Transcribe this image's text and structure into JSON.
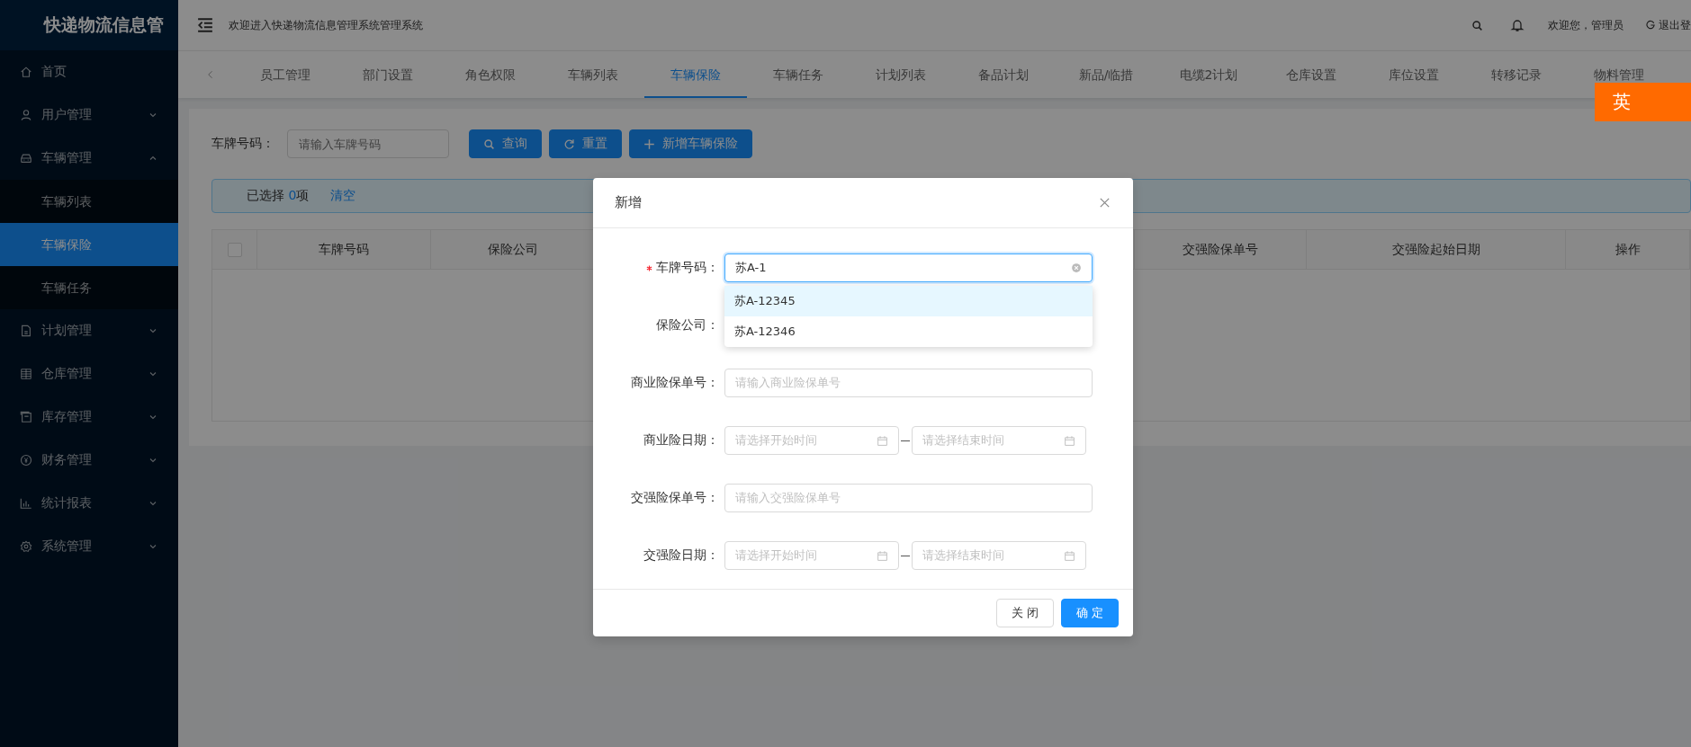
{
  "sidebar": {
    "logo": "快递物流信息管",
    "items": [
      {
        "label": "首页",
        "selected": false
      },
      {
        "label": "用户管理",
        "selected": false,
        "expanded": false
      },
      {
        "label": "车辆管理",
        "selected": false,
        "expanded": true,
        "children": [
          {
            "label": "车辆列表",
            "selected": false
          },
          {
            "label": "车辆保险",
            "selected": true
          },
          {
            "label": "车辆任务",
            "selected": false
          }
        ]
      },
      {
        "label": "计划管理",
        "selected": false,
        "expanded": false
      },
      {
        "label": "仓库管理",
        "selected": false,
        "expanded": false
      },
      {
        "label": "库存管理",
        "selected": false,
        "expanded": false
      },
      {
        "label": "财务管理",
        "selected": false,
        "expanded": false
      },
      {
        "label": "统计报表",
        "selected": false,
        "expanded": false
      },
      {
        "label": "系统管理",
        "selected": false,
        "expanded": false
      }
    ]
  },
  "header": {
    "title": "欢迎进入快递物流信息管理系统管理系统",
    "user": "欢迎您，管理员",
    "logout": "退出登"
  },
  "tabs": [
    {
      "label": "员工管理",
      "selected": false
    },
    {
      "label": "部门设置",
      "selected": false
    },
    {
      "label": "角色权限",
      "selected": false
    },
    {
      "label": "车辆列表",
      "selected": false
    },
    {
      "label": "车辆保险",
      "selected": true
    },
    {
      "label": "车辆任务",
      "selected": false
    },
    {
      "label": "计划列表",
      "selected": false
    },
    {
      "label": "备品计划",
      "selected": false
    },
    {
      "label": "新品/临措",
      "selected": false
    },
    {
      "label": "电缆2计划",
      "selected": false
    },
    {
      "label": "仓库设置",
      "selected": false
    },
    {
      "label": "库位设置",
      "selected": false
    },
    {
      "label": "转移记录",
      "selected": false
    },
    {
      "label": "物料管理",
      "selected": false
    }
  ],
  "ime_badge": "英",
  "search": {
    "label": "车牌号码：",
    "placeholder": "请输入车牌号码",
    "buttons": [
      {
        "label": "查询"
      },
      {
        "label": "重置"
      },
      {
        "label": "新增车辆保险"
      }
    ]
  },
  "selection_bar": {
    "prefix": "已选择 ",
    "count": "0",
    "suffix": "项",
    "clear": "清空"
  },
  "table": {
    "columns": [
      {
        "kind": "checkbox",
        "checked": false
      },
      {
        "label": "车牌号码"
      },
      {
        "label": "保险公司"
      },
      {
        "label": "交强险保单号"
      },
      {
        "label": "交强险起始日期"
      },
      {
        "label": "操作"
      }
    ]
  },
  "dialog": {
    "title": "新增",
    "fields": [
      {
        "label": "车牌号码：",
        "required": true,
        "kind": "autocomplete",
        "value": "苏A-1",
        "focused": true,
        "suggestions": [
          {
            "text": "苏A-12345",
            "selected": true
          },
          {
            "text": "苏A-12346",
            "selected": false
          }
        ]
      },
      {
        "label": "保险公司：",
        "required": false,
        "kind": "text"
      },
      {
        "label": "商业险保单号：",
        "required": false,
        "kind": "text",
        "placeholder": "请输入商业险保单号"
      },
      {
        "label": "商业险日期：",
        "required": false,
        "kind": "daterange",
        "start_placeholder": "请选择开始时间",
        "end_placeholder": "请选择结束时间"
      },
      {
        "label": "交强险保单号：",
        "required": false,
        "kind": "text",
        "placeholder": "请输入交强险保单号"
      },
      {
        "label": "交强险日期：",
        "required": false,
        "kind": "daterange",
        "start_placeholder": "请选择开始时间",
        "end_placeholder": "请选择结束时间"
      }
    ],
    "buttons": [
      {
        "label": "关 闭",
        "kind": "default"
      },
      {
        "label": "确 定",
        "kind": "primary"
      }
    ]
  }
}
